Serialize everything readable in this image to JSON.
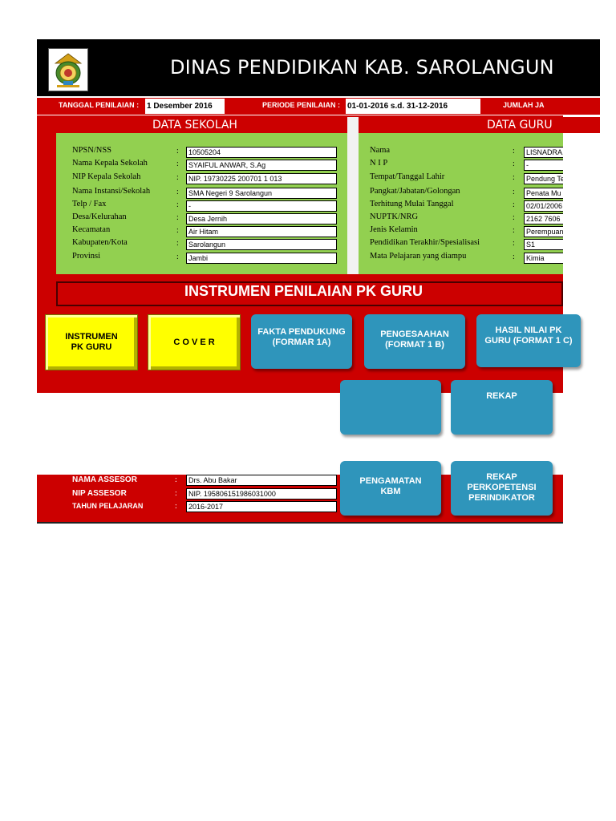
{
  "header": {
    "title": "DINAS PENDIDIKAN KAB. SAROLANGUN",
    "logo_icon": "regency-crest-icon"
  },
  "info_strip": {
    "tanggal_label": "TANGGAL PENILAIAN :",
    "tanggal_value": "1 Desember 2016",
    "periode_label": "PERIODE PENILAIAN :",
    "periode_value": "01-01-2016 s.d. 31-12-2016",
    "jumlah_label": "JUMLAH JA"
  },
  "data_sekolah": {
    "heading": "DATA SEKOLAH",
    "rows": [
      {
        "label": "NPSN/NSS",
        "value": "10505204"
      },
      {
        "label": "Nama Kepala Sekolah",
        "value": "SYAIFUL ANWAR, S.Ag"
      },
      {
        "label": "NIP Kepala Sekolah",
        "value": "NIP. 19730225 200701 1 013"
      },
      {
        "label": "Nama Instansi/Sekolah",
        "value": "SMA Negeri  9 Sarolangun"
      },
      {
        "label": "Telp / Fax",
        "value": "-"
      },
      {
        "label": "Desa/Kelurahan",
        "value": "Desa Jernih"
      },
      {
        "label": "Kecamatan",
        "value": "Air Hitam"
      },
      {
        "label": "Kabupaten/Kota",
        "value": "Sarolangun"
      },
      {
        "label": "Provinsi",
        "value": "Jambi"
      }
    ]
  },
  "data_guru": {
    "heading": "DATA GURU",
    "rows": [
      {
        "label": "Nama",
        "value": "LISNADRA,"
      },
      {
        "label": "N I P",
        "value": "-"
      },
      {
        "label": "Tempat/Tanggal Lahir",
        "value": "Pendung Te"
      },
      {
        "label": "Pangkat/Jabatan/Golongan",
        "value": "Penata Mu"
      },
      {
        "label": "Terhitung Mulai Tanggal",
        "value": "02/01/2006"
      },
      {
        "label": "NUPTK/NRG",
        "value": "2162 7606"
      },
      {
        "label": "Jenis Kelamin",
        "value": "Perempuan"
      },
      {
        "label": "Pendidikan Terakhir/Spesialisasi",
        "value": "S1"
      },
      {
        "label": "Mata Pelajaran yang diampu",
        "value": "Kimia"
      }
    ]
  },
  "colon": ":",
  "banner": "INSTRUMEN PENILAIAN PK GURU",
  "buttons": {
    "instrumen": "INSTRUMEN PK GURU",
    "cover": "C O V E R",
    "fakta": "FAKTA PENDUKUNG (FORMAR 1A)",
    "pengesahan": "PENGESAAHAN (FORMAT 1 B)",
    "hasil": "HASIL NILAI PK GURU        (FORMAT 1 C)",
    "blank": "",
    "rekap_top": "REKAP",
    "pengamatan": "PENGAMATAN KBM",
    "rekap_perkompetensi": "REKAP PERKOPETENSI PERINDIKATOR"
  },
  "assessor": {
    "nama_label": "NAMA ASSESOR",
    "nama_value": "Drs. Abu Bakar",
    "nip_label": "NIP ASSESOR",
    "nip_value": "NIP. 195806151986031000",
    "tahun_label": "TAHUN PELAJARAN",
    "tahun_value": "2016-2017"
  },
  "colors": {
    "red": "#cc0000",
    "green": "#92d050",
    "button_blue": "#2f95bb",
    "button_yellow": "#ffff00",
    "header_black": "#000000"
  }
}
